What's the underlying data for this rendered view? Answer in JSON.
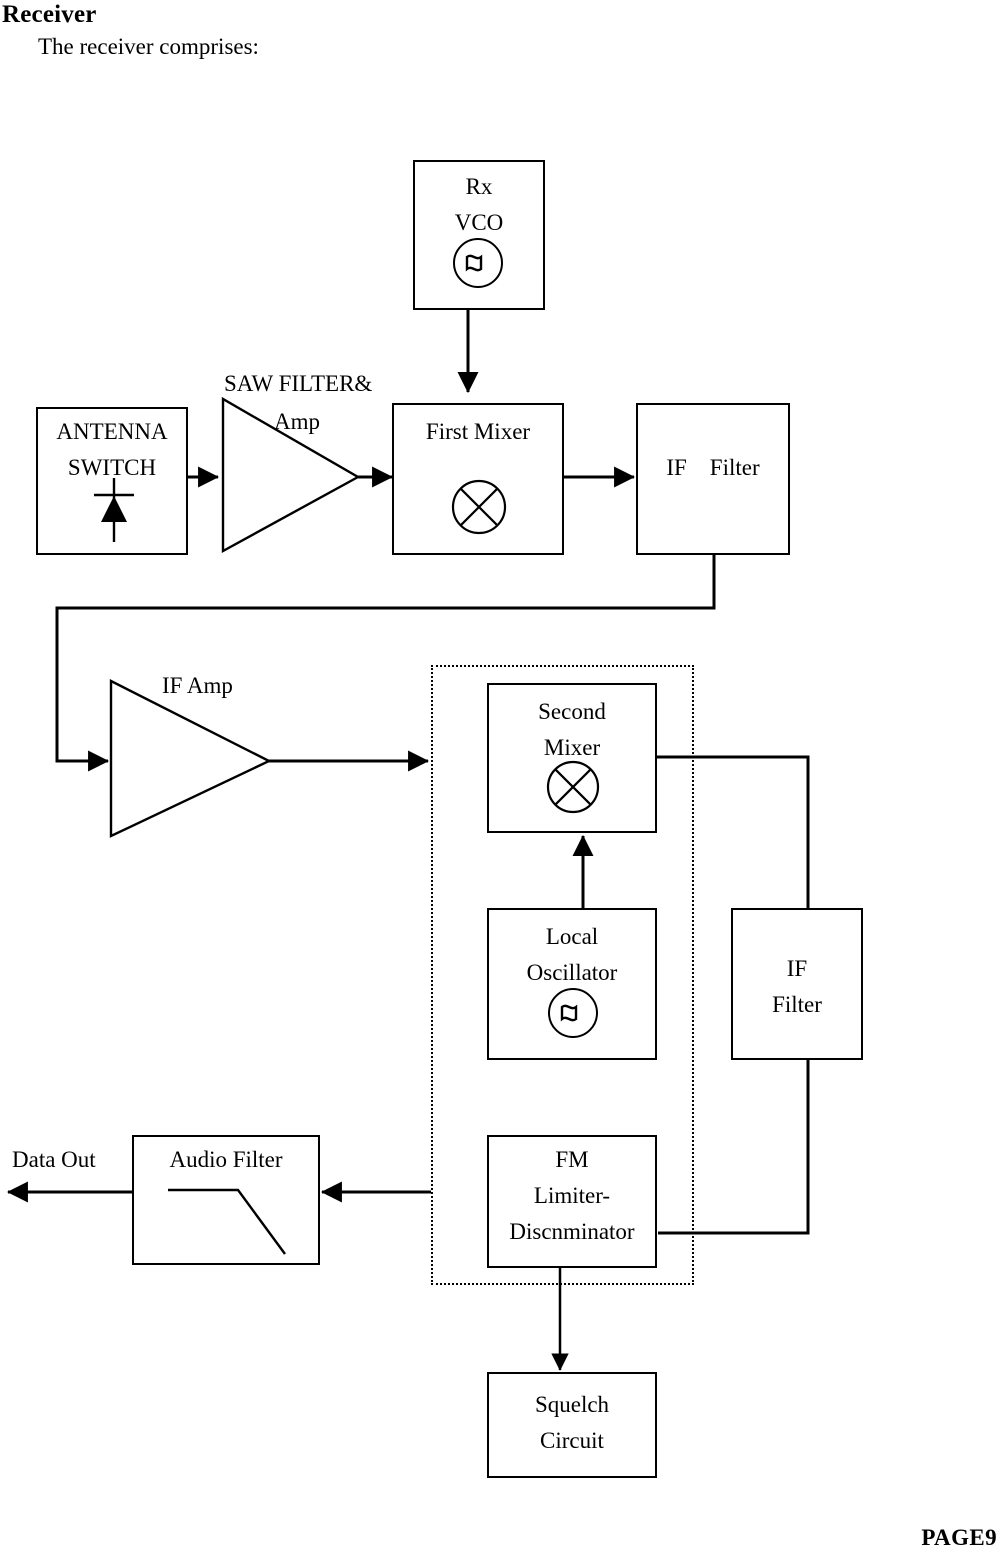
{
  "page": {
    "heading": "Receiver",
    "intro": "The receiver comprises:",
    "footer": "PAGE9"
  },
  "diagram": {
    "title": "Receiver block diagram",
    "blocks": {
      "rx_vco": {
        "line1": "Rx",
        "line2": "VCO",
        "symbol": "oscillator-icon"
      },
      "antenna_switch": {
        "line1": "ANTENNA",
        "line2": "SWITCH",
        "symbol": "diode-icon"
      },
      "saw_filter": {
        "line1": "SAW FILTER&",
        "line2": "Amp",
        "symbol": "amplifier-triangle-icon"
      },
      "first_mixer": {
        "line1": "First Mixer",
        "symbol": "mixer-icon"
      },
      "if_filter_1": {
        "line1": "IF    Filter"
      },
      "if_amp": {
        "line1": "IF Amp",
        "symbol": "amplifier-triangle-icon"
      },
      "second_mixer": {
        "line1": "Second",
        "line2": "Mixer",
        "symbol": "mixer-icon"
      },
      "local_oscillator": {
        "line1": "Local",
        "line2": "Oscillator",
        "symbol": "oscillator-icon"
      },
      "if_filter_2": {
        "line1": "IF",
        "line2": "Filter"
      },
      "fm_limiter": {
        "line1": "FM",
        "line2": "Limiter-",
        "line3": "Discnminator"
      },
      "audio_filter": {
        "line1": "Audio Filter",
        "symbol": "lowpass-response-icon"
      },
      "squelch": {
        "line1": "Squelch",
        "line2": "Circuit"
      },
      "data_out": {
        "line1": "Data Out"
      }
    },
    "colors": {
      "stroke": "#000000",
      "background": "#ffffff"
    }
  }
}
